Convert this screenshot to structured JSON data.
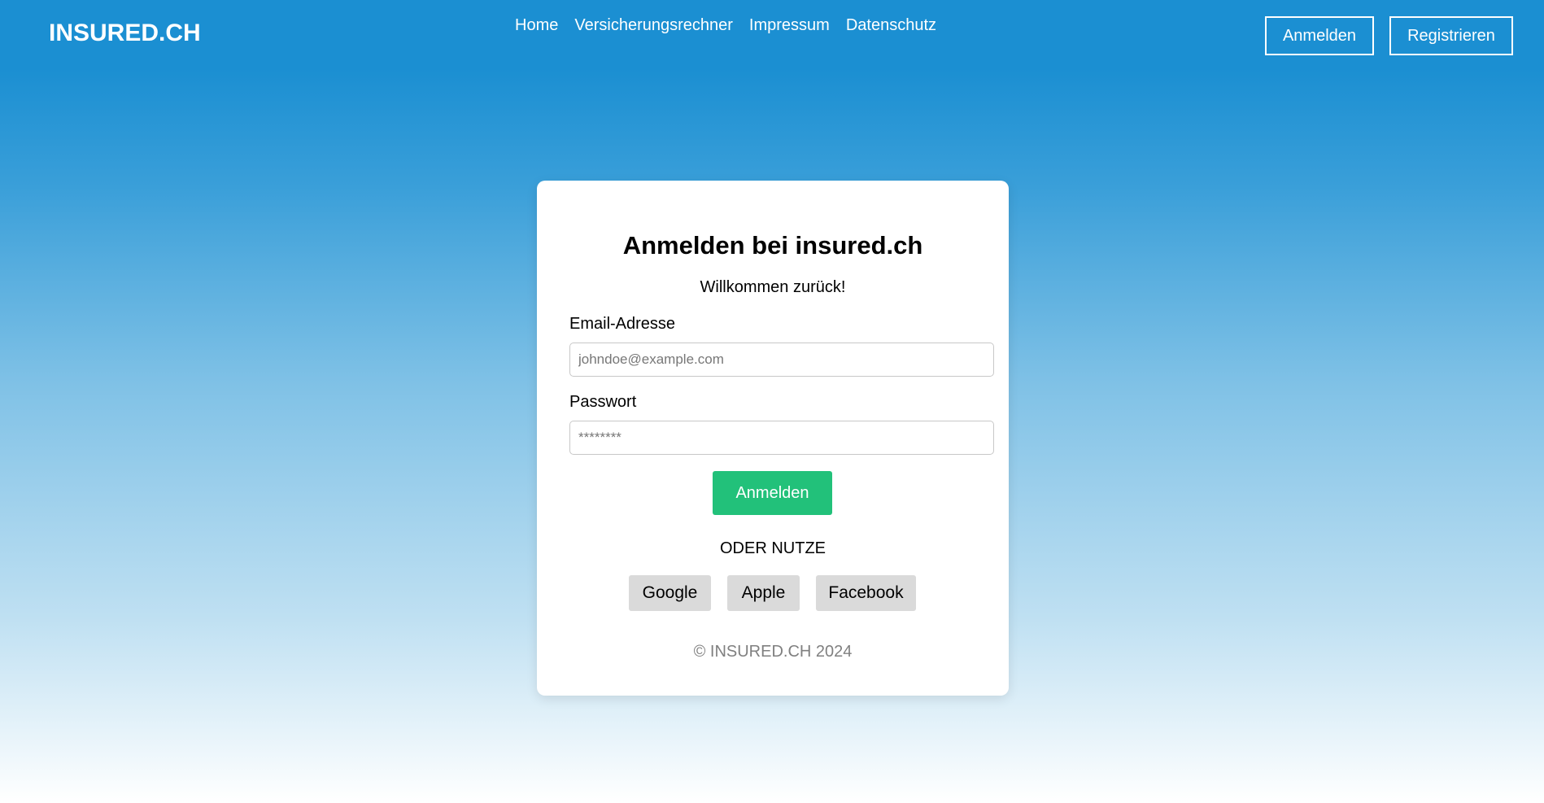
{
  "header": {
    "logo": "INSURED.CH",
    "nav": [
      {
        "label": "Home"
      },
      {
        "label": "Versicherungsrechner"
      },
      {
        "label": "Impressum"
      },
      {
        "label": "Datenschutz"
      }
    ],
    "login_label": "Anmelden",
    "register_label": "Registrieren"
  },
  "card": {
    "title": "Anmelden bei insured.ch",
    "subtitle": "Willkommen zurück!",
    "email_label": "Email-Adresse",
    "email_placeholder": "johndoe@example.com",
    "email_value": "",
    "password_label": "Passwort",
    "password_placeholder": "********",
    "password_value": "",
    "submit_label": "Anmelden",
    "divider_text": "ODER NUTZE",
    "social": [
      {
        "label": "Google"
      },
      {
        "label": "Apple"
      },
      {
        "label": "Facebook"
      }
    ],
    "footer": "© INSURED.CH 2024"
  },
  "colors": {
    "header_blue": "#1b8fd2",
    "submit_green": "#22c17a",
    "social_gray": "#dadada",
    "footer_gray": "#808080"
  }
}
